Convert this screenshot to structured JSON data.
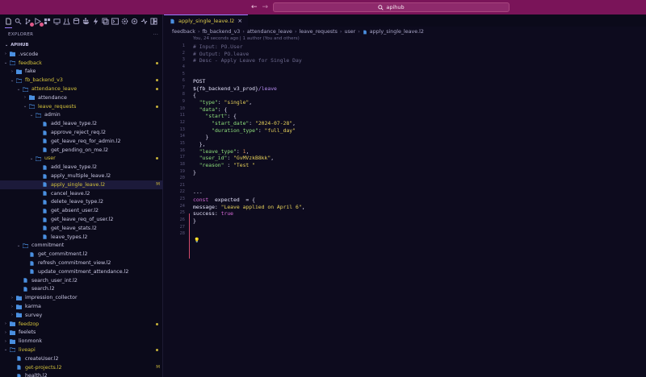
{
  "titlebar": {
    "search_text": "apihub"
  },
  "sidebar": {
    "header": "EXPLORER",
    "more": "···",
    "root": "APIHUB",
    "tree": [
      {
        "label": ".vscode",
        "depth": 1,
        "type": "folder",
        "open": false
      },
      {
        "label": "feedback",
        "depth": 1,
        "type": "folder",
        "open": true,
        "modified": true,
        "status": "dot"
      },
      {
        "label": "fake",
        "depth": 2,
        "type": "folder",
        "open": false
      },
      {
        "label": "fb_backend_v3",
        "depth": 2,
        "type": "folder",
        "open": true,
        "modified": true,
        "status": "dot"
      },
      {
        "label": "attendance_leave",
        "depth": 3,
        "type": "folder",
        "open": true,
        "modified": true,
        "status": "dot"
      },
      {
        "label": "attendance",
        "depth": 4,
        "type": "folder",
        "open": false
      },
      {
        "label": "leave_requests",
        "depth": 4,
        "type": "folder",
        "open": true,
        "modified": true,
        "status": "dot"
      },
      {
        "label": "admin",
        "depth": 5,
        "type": "folder",
        "open": true
      },
      {
        "label": "add_leave_type.l2",
        "depth": 6,
        "type": "file"
      },
      {
        "label": "approve_reject_req.l2",
        "depth": 6,
        "type": "file"
      },
      {
        "label": "get_leave_req_for_admin.l2",
        "depth": 6,
        "type": "file"
      },
      {
        "label": "get_pending_on_me.l2",
        "depth": 6,
        "type": "file"
      },
      {
        "label": "user",
        "depth": 5,
        "type": "folder",
        "open": true,
        "modified": true,
        "status": "dot"
      },
      {
        "label": "add_leave_type.l2",
        "depth": 6,
        "type": "file"
      },
      {
        "label": "apply_multiple_leave.l2",
        "depth": 6,
        "type": "file"
      },
      {
        "label": "apply_single_leave.l2",
        "depth": 6,
        "type": "file",
        "modified": true,
        "selected": true,
        "status": "M"
      },
      {
        "label": "cancel_leave.l2",
        "depth": 6,
        "type": "file"
      },
      {
        "label": "delete_leave_type.l2",
        "depth": 6,
        "type": "file"
      },
      {
        "label": "get_absent_user.l2",
        "depth": 6,
        "type": "file"
      },
      {
        "label": "get_leave_req_of_user.l2",
        "depth": 6,
        "type": "file"
      },
      {
        "label": "get_leave_stats.l2",
        "depth": 6,
        "type": "file"
      },
      {
        "label": "leave_types.l2",
        "depth": 6,
        "type": "file"
      },
      {
        "label": "commitment",
        "depth": 3,
        "type": "folder",
        "open": true
      },
      {
        "label": "get_commitment.l2",
        "depth": 4,
        "type": "file"
      },
      {
        "label": "refresh_commitment_view.l2",
        "depth": 4,
        "type": "file"
      },
      {
        "label": "update_commitment_attendance.l2",
        "depth": 4,
        "type": "file"
      },
      {
        "label": "search_user_int.l2",
        "depth": 3,
        "type": "file"
      },
      {
        "label": "search.l2",
        "depth": 3,
        "type": "file"
      },
      {
        "label": "impression_collector",
        "depth": 2,
        "type": "folder",
        "open": false
      },
      {
        "label": "karma",
        "depth": 2,
        "type": "folder",
        "open": false
      },
      {
        "label": "survey",
        "depth": 2,
        "type": "folder",
        "open": false
      },
      {
        "label": "feedzop",
        "depth": 1,
        "type": "folder",
        "open": false,
        "modified": true,
        "status": "dot"
      },
      {
        "label": "feelets",
        "depth": 1,
        "type": "folder",
        "open": false
      },
      {
        "label": "lionmonk",
        "depth": 1,
        "type": "folder",
        "open": false
      },
      {
        "label": "liveapi",
        "depth": 1,
        "type": "folder",
        "open": true,
        "modified": true,
        "status": "dot"
      },
      {
        "label": "createUser.l2",
        "depth": 2,
        "type": "file"
      },
      {
        "label": "get-projects.l2",
        "depth": 2,
        "type": "file",
        "modified": true,
        "status": "M"
      },
      {
        "label": "health.l2",
        "depth": 2,
        "type": "file"
      }
    ]
  },
  "editor": {
    "tab_label": "apply_single_leave.l2",
    "tab_close": "×",
    "breadcrumbs": [
      "feedback",
      "fb_backend_v3",
      "attendance_leave",
      "leave_requests",
      "user",
      "apply_single_leave.l2"
    ],
    "blame": "You, 24 seconds ago | 1 author (You and others)",
    "lines": [
      [
        [
          "c-com",
          "# Input: PO.User"
        ]
      ],
      [
        [
          "c-com",
          "# Output: PO.leave"
        ]
      ],
      [
        [
          "c-com",
          "# Desc - Apply Leave for Single Day"
        ]
      ],
      [],
      [],
      [
        [
          "c-var",
          "POST"
        ]
      ],
      [
        [
          "c-var",
          "${fb_backend_v3_prod}"
        ],
        [
          "c-pur",
          "/leave"
        ]
      ],
      [
        [
          "c-var",
          "{"
        ]
      ],
      [
        [
          "c-var",
          "  "
        ],
        [
          "c-key",
          "\"type\""
        ],
        [
          "c-var",
          ": "
        ],
        [
          "c-str",
          "\"single\""
        ],
        [
          "c-var",
          ","
        ]
      ],
      [
        [
          "c-var",
          "  "
        ],
        [
          "c-key",
          "\"data\""
        ],
        [
          "c-var",
          ": {"
        ]
      ],
      [
        [
          "c-var",
          "    "
        ],
        [
          "c-key",
          "\"start\""
        ],
        [
          "c-var",
          ": {"
        ]
      ],
      [
        [
          "c-var",
          "      "
        ],
        [
          "c-key",
          "\"start_date\""
        ],
        [
          "c-var",
          ": "
        ],
        [
          "c-str",
          "\"2024-07-28\""
        ],
        [
          "c-var",
          ","
        ]
      ],
      [
        [
          "c-var",
          "      "
        ],
        [
          "c-key",
          "\"duration_type\""
        ],
        [
          "c-var",
          ": "
        ],
        [
          "c-str",
          "\"full_day\""
        ]
      ],
      [
        [
          "c-var",
          "    }"
        ]
      ],
      [
        [
          "c-var",
          "  },"
        ]
      ],
      [
        [
          "c-var",
          "  "
        ],
        [
          "c-key",
          "\"leave_type\""
        ],
        [
          "c-var",
          ": "
        ],
        [
          "c-num",
          "1"
        ],
        [
          "c-var",
          ","
        ]
      ],
      [
        [
          "c-var",
          "  "
        ],
        [
          "c-key",
          "\"user_id\""
        ],
        [
          "c-var",
          ": "
        ],
        [
          "c-str",
          "\"GvMVzkB8kk\""
        ],
        [
          "c-var",
          ","
        ]
      ],
      [
        [
          "c-var",
          "  "
        ],
        [
          "c-key",
          "\"reason\""
        ],
        [
          "c-var",
          " : "
        ],
        [
          "c-str",
          "\"Test \""
        ]
      ],
      [
        [
          "c-var",
          "}"
        ]
      ],
      [],
      [],
      [
        [
          "c-var",
          "---"
        ]
      ],
      [
        [
          "c-kw",
          "const"
        ],
        [
          "c-var",
          "  expected  = {"
        ]
      ],
      [
        [
          "c-var",
          "message: "
        ],
        [
          "c-str",
          "\"Leave applied on April 6\""
        ],
        [
          "c-var",
          ","
        ]
      ],
      [
        [
          "c-var",
          "success: "
        ],
        [
          "c-kw",
          "true"
        ]
      ],
      [
        [
          "c-var",
          "}"
        ]
      ],
      [],
      []
    ]
  },
  "colors": {
    "titlebar": "#7a1459",
    "accent": "#9a7bff",
    "modified": "#c7b23a",
    "background": "#0d0b1e"
  }
}
